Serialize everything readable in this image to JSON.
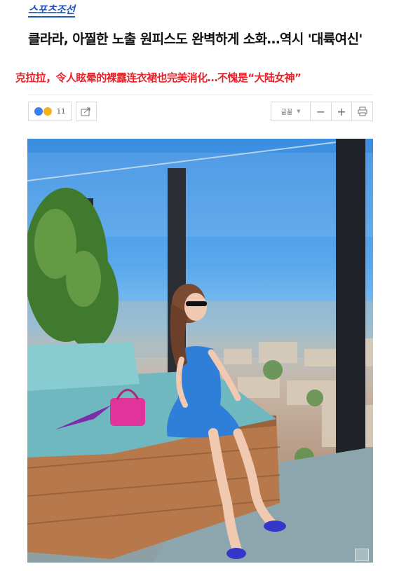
{
  "header": {
    "brand": "스포츠조선",
    "title": "클라라, 아찔한 노출 원피스도 완벽하게 소화…역시 '대륙여신'",
    "subtitle": "克拉拉，令人眩晕的裸露连衣裙也完美消化…不愧是“大陆女神”"
  },
  "toolbar": {
    "reaction_count": "11",
    "font_label": "글꼴",
    "zoom_out": "−",
    "zoom_in": "+"
  },
  "icons": {
    "reaction": "emoji-reaction-icon",
    "share": "share-icon",
    "font_caret": "caret-down-icon",
    "print": "print-icon",
    "photo_zoom": "zoom-icon"
  },
  "colors": {
    "brand": "#1f56c9",
    "subtitle": "#e8222a",
    "dress": "#2f7fd8",
    "handbag": "#e0349a",
    "sky": "#3a8de0"
  }
}
